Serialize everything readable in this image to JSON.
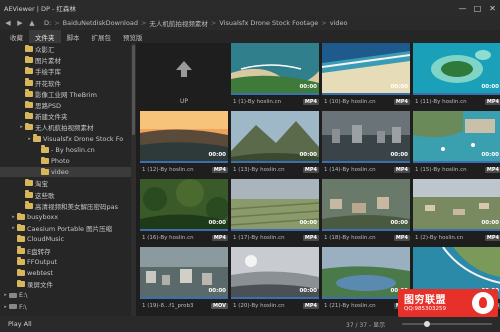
{
  "window": {
    "title": "AEViewer | DP - 红森林"
  },
  "path": {
    "crumbs": [
      "D:",
      "BaiduNetdiskDownload",
      "无人机航拍视频素材",
      "Visualsfx Drone Stock Footage",
      "video"
    ]
  },
  "tabs": [
    {
      "label": "收藏",
      "active": false
    },
    {
      "label": "文件夹",
      "active": true
    },
    {
      "label": "脚本",
      "active": false
    },
    {
      "label": "扩展包",
      "active": false
    },
    {
      "label": "预览版",
      "active": false
    }
  ],
  "tree": [
    {
      "label": "众影汇",
      "indent": 3,
      "expander": false
    },
    {
      "label": "图片素材",
      "indent": 3,
      "expander": false
    },
    {
      "label": "手绘字库",
      "indent": 3,
      "expander": false
    },
    {
      "label": "开花软件",
      "indent": 3,
      "expander": false
    },
    {
      "label": "影像工业网 TheBrim",
      "indent": 3,
      "expander": false
    },
    {
      "label": "思路PSD",
      "indent": 3,
      "expander": false
    },
    {
      "label": "新建文件夹",
      "indent": 3,
      "expander": false
    },
    {
      "label": "无人机航拍视频素材",
      "indent": 3,
      "expander": true
    },
    {
      "label": "Visualsfx Drone Stock Fo",
      "indent": 4,
      "expander": true
    },
    {
      "label": "- By hoslin.cn",
      "indent": 5,
      "expander": false
    },
    {
      "label": "Photo",
      "indent": 5,
      "expander": false
    },
    {
      "label": "video",
      "indent": 5,
      "expander": false,
      "selected": true
    },
    {
      "label": "淘宝",
      "indent": 3,
      "expander": false
    },
    {
      "label": "这些歌",
      "indent": 3,
      "expander": false
    },
    {
      "label": "高清视频和美女解压密码pas",
      "indent": 3,
      "expander": false
    },
    {
      "label": "busyboxx",
      "indent": 2,
      "expander": true
    },
    {
      "label": "Caesium Portable 图片压缩",
      "indent": 2,
      "expander": true
    },
    {
      "label": "CloudMusic",
      "indent": 2,
      "expander": false
    },
    {
      "label": "E盘转存",
      "indent": 2,
      "expander": false
    },
    {
      "label": "FFOutput",
      "indent": 2,
      "expander": false
    },
    {
      "label": "webtest",
      "indent": 2,
      "expander": false
    },
    {
      "label": "录屏文件",
      "indent": 2,
      "expander": false
    },
    {
      "label": "E:\\",
      "indent": 1,
      "expander": true,
      "drive": true
    },
    {
      "label": "F:\\",
      "indent": 1,
      "expander": true,
      "drive": true
    }
  ],
  "up": {
    "label": "UP"
  },
  "clips": [
    {
      "name": "1 (1)-By hoslin.cn",
      "duration": "00:00",
      "format": "MP4",
      "scene": "coast"
    },
    {
      "name": "1 (10)-By hoslin.cn",
      "duration": "00:00",
      "format": "MP4",
      "scene": "beach"
    },
    {
      "name": "1 (11)-By hoslin.cn",
      "duration": "00:00",
      "format": "MP4",
      "scene": "island"
    },
    {
      "name": "1 (12)-By hoslin.cn",
      "duration": "00:00",
      "format": "MP4",
      "scene": "sunset"
    },
    {
      "name": "1 (13)-By hoslin.cn",
      "duration": "00:00",
      "format": "MP4",
      "scene": "mountain"
    },
    {
      "name": "1 (14)-By hoslin.cn",
      "duration": "00:00",
      "format": "MP4",
      "scene": "city"
    },
    {
      "name": "1 (15)-By hoslin.cn",
      "duration": "00:00",
      "format": "MP4",
      "scene": "harbor"
    },
    {
      "name": "1 (16)-By hoslin.cn",
      "duration": "00:00",
      "format": "MP4",
      "scene": "forest"
    },
    {
      "name": "1 (17)-By hoslin.cn",
      "duration": "00:00",
      "format": "MP4",
      "scene": "field"
    },
    {
      "name": "1 (18)-By hoslin.cn",
      "duration": "00:00",
      "format": "MP4",
      "scene": "town"
    },
    {
      "name": "1 (2)-By hoslin.cn",
      "duration": "00:00",
      "format": "MP4",
      "scene": "village"
    },
    {
      "name": "1 (19)-8...f1_prob3",
      "duration": "00:00",
      "format": "MOV",
      "scene": "aerialcity"
    },
    {
      "name": "1 (20)-By hoslin.cn",
      "duration": "00:00",
      "format": "MP4",
      "scene": "fog"
    },
    {
      "name": "1 (21)-By hoslin.cn",
      "duration": "00:00",
      "format": "MP4",
      "scene": "lake"
    },
    {
      "name": "1 (22)-By hoslin.cn",
      "duration": "00:00",
      "format": "MP4",
      "scene": "seashore"
    }
  ],
  "status": {
    "play_all": "Play All",
    "count": "37 / 37 - 显示"
  },
  "watermark": {
    "text": "图穷联盟",
    "qq": "QQ:985303259"
  }
}
